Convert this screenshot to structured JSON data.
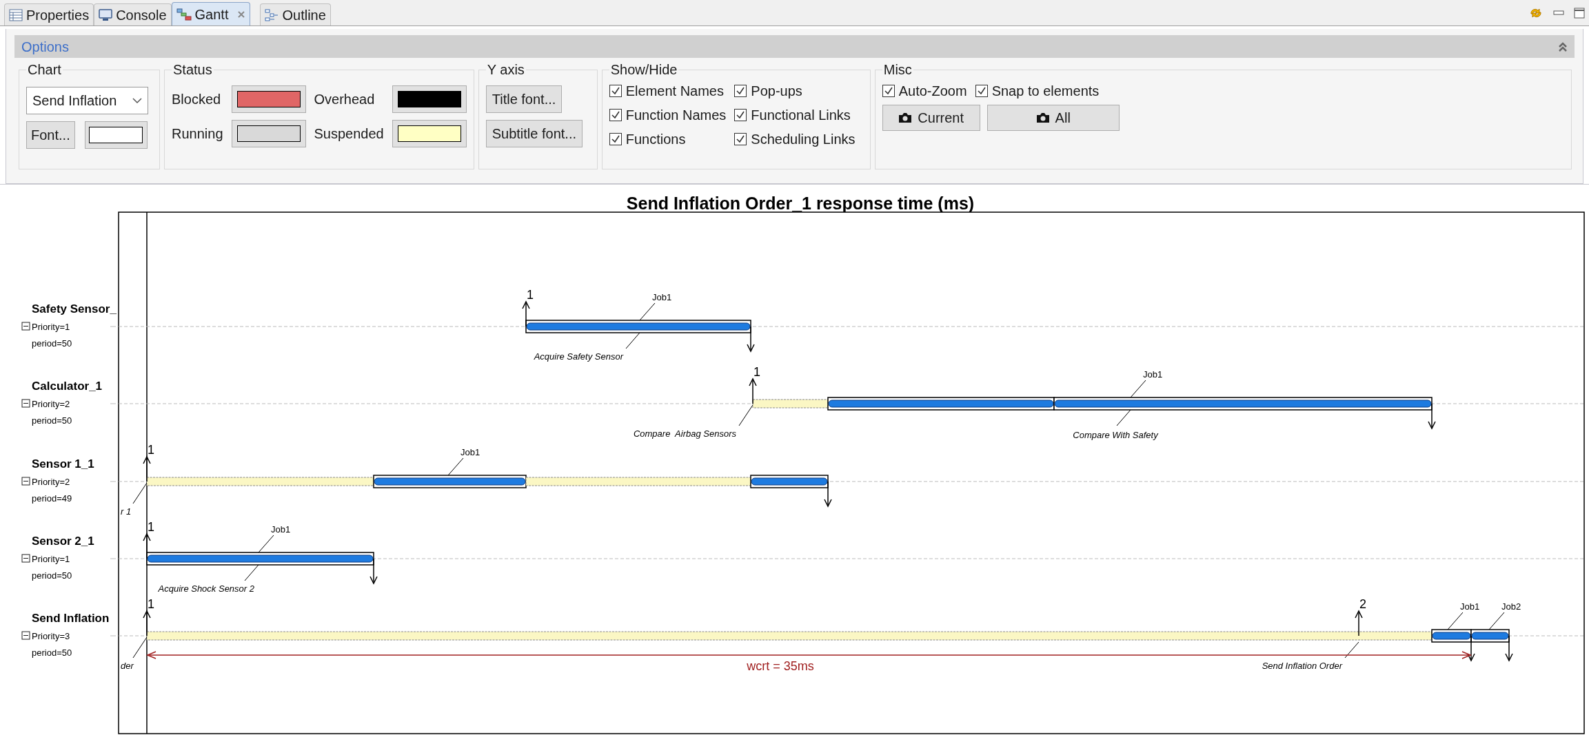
{
  "tabs": [
    {
      "label": "Properties",
      "selected": false,
      "closable": false
    },
    {
      "label": "Console",
      "selected": false,
      "closable": false
    },
    {
      "label": "Gantt",
      "selected": true,
      "closable": true
    },
    {
      "label": "Outline",
      "selected": false,
      "closable": false
    }
  ],
  "options": {
    "title": "Options",
    "chart": {
      "legend": "Chart",
      "dropdown": "Send Inflation",
      "font_button": "Font..."
    },
    "status": {
      "legend": "Status",
      "items": [
        {
          "label": "Blocked",
          "color": "#e06666"
        },
        {
          "label": "Overhead",
          "color": "#000000"
        },
        {
          "label": "Running",
          "color": "#d9d9d9"
        },
        {
          "label": "Suspended",
          "color": "#ffffc4"
        }
      ]
    },
    "y_axis": {
      "legend": "Y axis",
      "buttons": [
        "Title font...",
        "Subtitle font..."
      ]
    },
    "show_hide": {
      "legend": "Show/Hide",
      "items": [
        {
          "label": "Element Names",
          "checked": true
        },
        {
          "label": "Function Names",
          "checked": true
        },
        {
          "label": "Functions",
          "checked": true
        },
        {
          "label": "Pop-ups",
          "checked": true
        },
        {
          "label": "Functional Links",
          "checked": true
        },
        {
          "label": "Scheduling Links",
          "checked": true
        }
      ]
    },
    "misc": {
      "legend": "Misc",
      "items": [
        {
          "label": "Auto-Zoom",
          "checked": true
        },
        {
          "label": "Snap to elements",
          "checked": true
        }
      ],
      "buttons": [
        "Current",
        "All"
      ]
    }
  },
  "gantt": {
    "title": "Send Inflation Order_1 response time (ms)",
    "rows": [
      {
        "name": "Safety Sensor_",
        "priority": "Priority=1",
        "period": "period=50",
        "expanded": true,
        "arrivals": [
          "1"
        ],
        "jobs": [
          "Job1"
        ],
        "functions": [
          "Acquire Safety Sensor"
        ]
      },
      {
        "name": "Calculator_1",
        "priority": "Priority=2",
        "period": "period=50",
        "expanded": true,
        "arrivals": [
          "1"
        ],
        "jobs": [
          "Job1"
        ],
        "functions": [
          "Compare  Airbag Sensors",
          "Compare With Safety"
        ]
      },
      {
        "name": "Sensor 1_1",
        "priority": "Priority=2",
        "period": "period=49",
        "expanded": true,
        "arrivals": [
          "1"
        ],
        "jobs": [
          "Job1"
        ],
        "functions": [
          "r 1"
        ]
      },
      {
        "name": "Sensor 2_1",
        "priority": "Priority=1",
        "period": "period=50",
        "expanded": true,
        "arrivals": [
          "1"
        ],
        "jobs": [
          "Job1"
        ],
        "functions": [
          "Acquire Shock Sensor 2"
        ]
      },
      {
        "name": "Send Inflation",
        "priority": "Priority=3",
        "period": "period=50",
        "expanded": true,
        "arrivals": [
          "1",
          "2"
        ],
        "jobs": [
          "Job1",
          "Job2"
        ],
        "functions": [
          "der",
          "Send Inflation Order"
        ]
      }
    ],
    "wcrt": "wcrt = 35ms"
  }
}
